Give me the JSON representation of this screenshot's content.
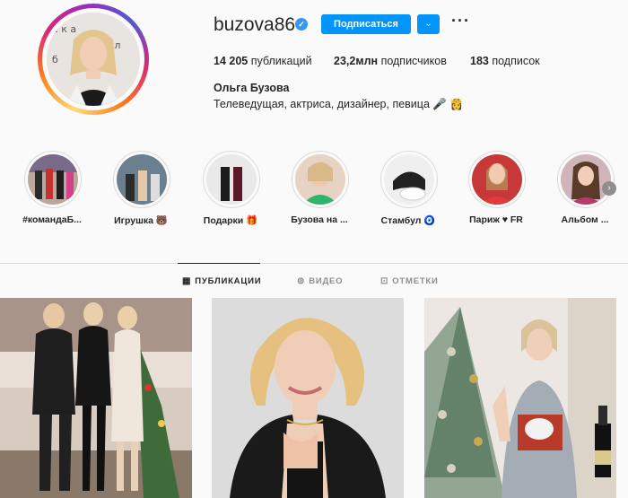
{
  "profile": {
    "username": "buzova86",
    "follow_label": "Подписаться",
    "dropdown_icon": "chevron-down-icon",
    "more_icon": "more-icon",
    "stats": {
      "posts_value": "14 205",
      "posts_label": "публикаций",
      "followers_value": "23,2млн",
      "followers_label": "подписчиков",
      "following_value": "183",
      "following_label": "подписок"
    },
    "full_name": "Ольга Бузова",
    "bio": "Телеведущая, актриса, дизайнер, певица 🎤 👸"
  },
  "stories": [
    {
      "label": "#командаБ..."
    },
    {
      "label": "Игрушка 🐻"
    },
    {
      "label": "Подарки 🎁"
    },
    {
      "label": "Бузова на ..."
    },
    {
      "label": "Стамбул 🧿"
    },
    {
      "label": "Париж ♥ FR"
    },
    {
      "label": "Альбом ..."
    }
  ],
  "tabs": [
    {
      "label": "ПУБЛИКАЦИИ",
      "icon": "grid-icon",
      "active": true
    },
    {
      "label": "ВИДЕО",
      "icon": "video-icon",
      "active": false
    },
    {
      "label": "ОТМЕТКИ",
      "icon": "tag-icon",
      "active": false
    }
  ],
  "colors": {
    "accent": "#0095f6",
    "verified": "#3897f0",
    "text": "#262626",
    "muted": "#8e8e8e"
  }
}
